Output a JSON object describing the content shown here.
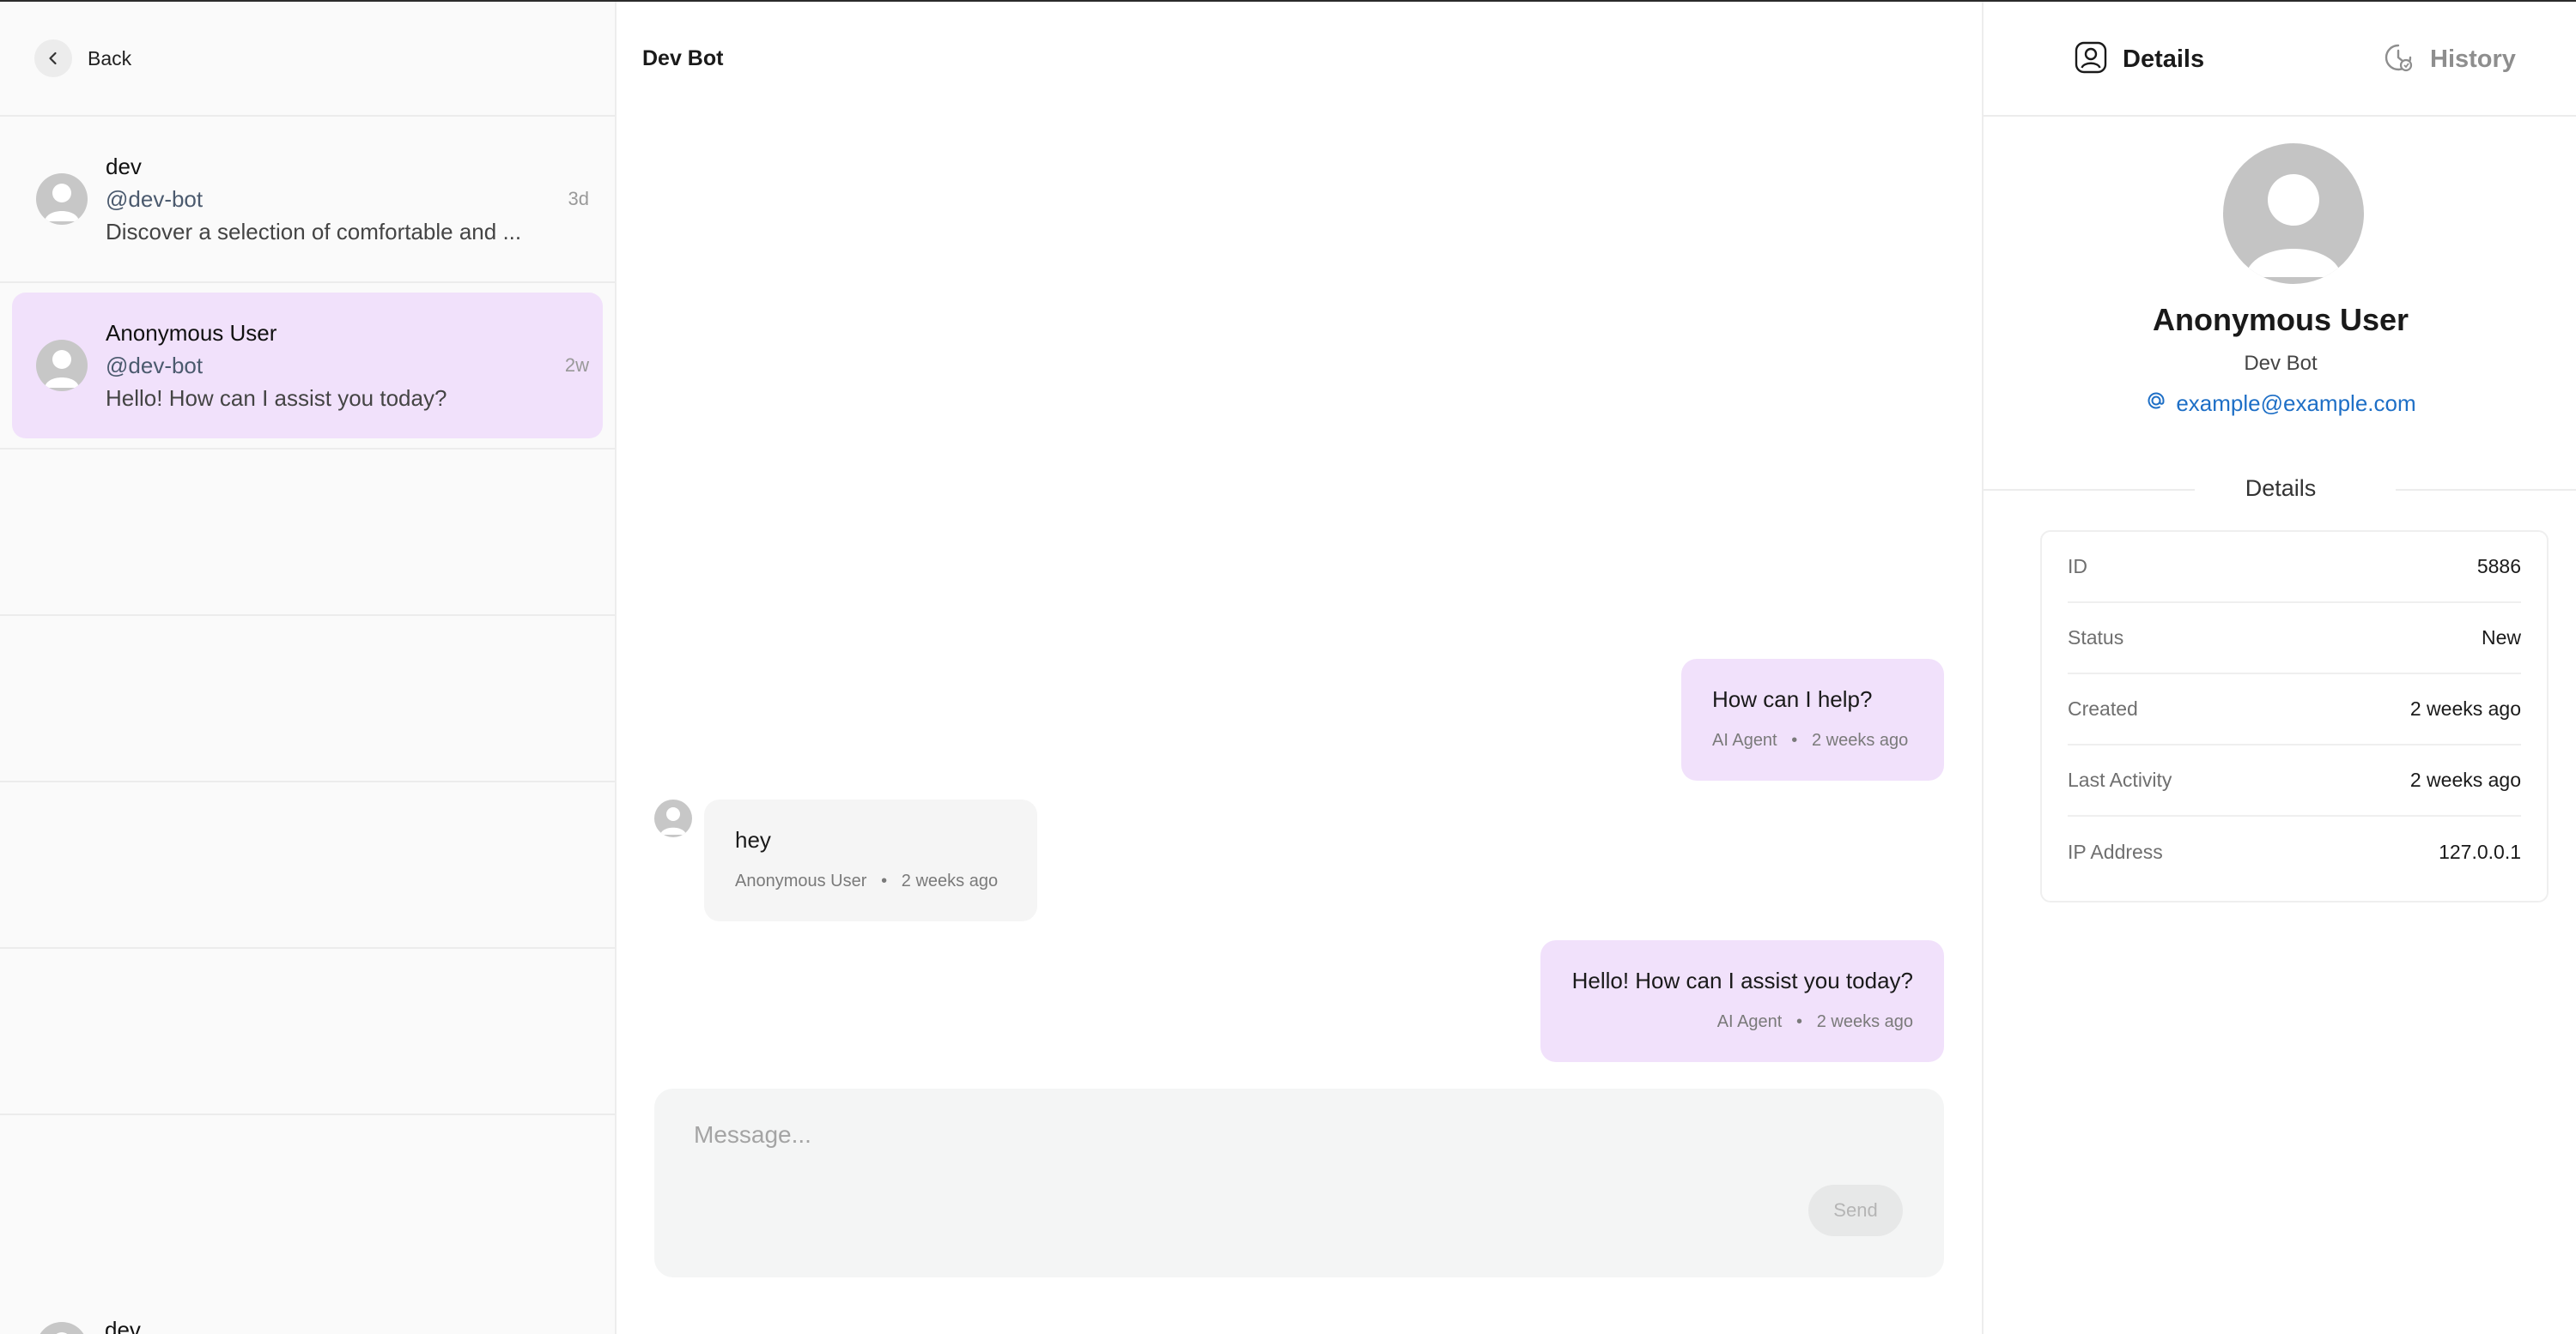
{
  "sidebar": {
    "back_label": "Back",
    "conversations": [
      {
        "name": "dev",
        "handle": "@dev-bot",
        "preview": "Discover a selection of comfortable and ...",
        "time": "3d",
        "active": false
      },
      {
        "name": "Anonymous User",
        "handle": "@dev-bot",
        "preview": "Hello! How can I assist you today?",
        "time": "2w",
        "active": true
      }
    ],
    "partial_conversation_name": "dev"
  },
  "chat": {
    "title": "Dev Bot",
    "messages": [
      {
        "role": "agent",
        "text": "How can I help?",
        "sender": "AI Agent",
        "time": "2 weeks ago"
      },
      {
        "role": "user",
        "text": "hey",
        "sender": "Anonymous User",
        "time": "2 weeks ago"
      },
      {
        "role": "agent",
        "text": "Hello! How can I assist you today?",
        "sender": "AI Agent",
        "time": "2 weeks ago"
      }
    ],
    "composer": {
      "placeholder": "Message...",
      "send_label": "Send"
    }
  },
  "right_panel": {
    "tabs": [
      {
        "label": "Details",
        "icon": "user-circle-icon",
        "active": true
      },
      {
        "label": "History",
        "icon": "clock-icon",
        "active": false
      }
    ],
    "profile": {
      "name": "Anonymous User",
      "subtitle": "Dev Bot",
      "email": "example@example.com"
    },
    "details_heading": "Details",
    "details": [
      {
        "label": "ID",
        "value": "5886"
      },
      {
        "label": "Status",
        "value": "New"
      },
      {
        "label": "Created",
        "value": "2 weeks ago"
      },
      {
        "label": "Last Activity",
        "value": "2 weeks ago"
      },
      {
        "label": "IP Address",
        "value": "127.0.0.1"
      }
    ]
  },
  "colors": {
    "accent_bubble": "#f1e1fb",
    "link": "#1e6fc6"
  }
}
